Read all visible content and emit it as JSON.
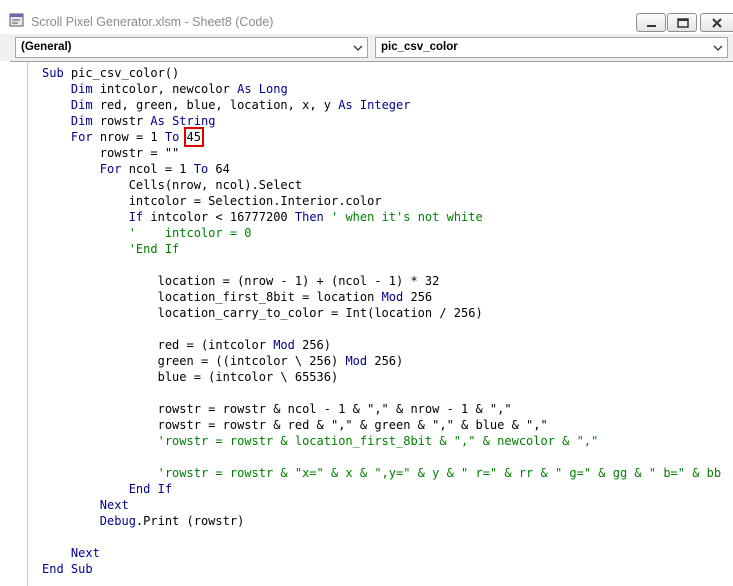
{
  "window": {
    "title": "Scroll Pixel Generator.xlsm - Sheet8 (Code)",
    "icon": "vba-module-icon"
  },
  "combos": {
    "object": "(General)",
    "procedure": "pic_csv_color"
  },
  "code_lines": [
    [
      {
        "t": "Sub",
        "k": "kw"
      },
      {
        "t": " pic_csv_color()"
      }
    ],
    [
      {
        "t": "    "
      },
      {
        "t": "Dim",
        "k": "kw"
      },
      {
        "t": " intcolor, newcolor "
      },
      {
        "t": "As Long",
        "k": "kw"
      }
    ],
    [
      {
        "t": "    "
      },
      {
        "t": "Dim",
        "k": "kw"
      },
      {
        "t": " red, green, blue, location, x, y "
      },
      {
        "t": "As Integer",
        "k": "kw"
      }
    ],
    [
      {
        "t": "    "
      },
      {
        "t": "Dim",
        "k": "kw"
      },
      {
        "t": " rowstr "
      },
      {
        "t": "As String",
        "k": "kw"
      }
    ],
    [
      {
        "t": "    "
      },
      {
        "t": "For",
        "k": "kw"
      },
      {
        "t": " nrow = 1 "
      },
      {
        "t": "To",
        "k": "kw"
      },
      {
        "t": " "
      },
      {
        "t": "45",
        "k": "hl"
      }
    ],
    [
      {
        "t": "        rowstr = \"\""
      }
    ],
    [
      {
        "t": "        "
      },
      {
        "t": "For",
        "k": "kw"
      },
      {
        "t": " ncol = 1 "
      },
      {
        "t": "To",
        "k": "kw"
      },
      {
        "t": " 64"
      }
    ],
    [
      {
        "t": "            Cells(nrow, ncol).Select"
      }
    ],
    [
      {
        "t": "            intcolor = Selection.Interior.color"
      }
    ],
    [
      {
        "t": "            "
      },
      {
        "t": "If",
        "k": "kw"
      },
      {
        "t": " intcolor < 16777200 "
      },
      {
        "t": "Then",
        "k": "kw"
      },
      {
        "t": " ' when it's not white",
        "k": "cm"
      }
    ],
    [
      {
        "t": "            '    intcolor = 0",
        "k": "cm"
      }
    ],
    [
      {
        "t": "            'End If",
        "k": "cm"
      }
    ],
    [
      {
        "t": ""
      }
    ],
    [
      {
        "t": "                location = (nrow - 1) + (ncol - 1) * 32"
      }
    ],
    [
      {
        "t": "                location_first_8bit = location "
      },
      {
        "t": "Mod",
        "k": "kw"
      },
      {
        "t": " 256"
      }
    ],
    [
      {
        "t": "                location_carry_to_color = Int(location / 256)"
      }
    ],
    [
      {
        "t": ""
      }
    ],
    [
      {
        "t": "                red = (intcolor "
      },
      {
        "t": "Mod",
        "k": "kw"
      },
      {
        "t": " 256)"
      }
    ],
    [
      {
        "t": "                green = ((intcolor \\ 256) "
      },
      {
        "t": "Mod",
        "k": "kw"
      },
      {
        "t": " 256)"
      }
    ],
    [
      {
        "t": "                blue = (intcolor \\ 65536)"
      }
    ],
    [
      {
        "t": ""
      }
    ],
    [
      {
        "t": "                rowstr = rowstr & ncol - 1 & \",\" & nrow - 1 & \",\""
      }
    ],
    [
      {
        "t": "                rowstr = rowstr & red & \",\" & green & \",\" & blue & \",\""
      }
    ],
    [
      {
        "t": "                'rowstr = rowstr & location_first_8bit & \",\" & newcolor & \",\"",
        "k": "cm"
      }
    ],
    [
      {
        "t": ""
      }
    ],
    [
      {
        "t": "                'rowstr = rowstr & \"x=\" & x & \",y=\" & y & \" r=\" & rr & \" g=\" & gg & \" b=\" & bb",
        "k": "cm"
      }
    ],
    [
      {
        "t": "            "
      },
      {
        "t": "End If",
        "k": "kw"
      }
    ],
    [
      {
        "t": "        "
      },
      {
        "t": "Next",
        "k": "kw"
      }
    ],
    [
      {
        "t": "        "
      },
      {
        "t": "Debug",
        "k": "kw"
      },
      {
        "t": ".Print (rowstr)"
      }
    ],
    [
      {
        "t": ""
      }
    ],
    [
      {
        "t": "    "
      },
      {
        "t": "Next",
        "k": "kw"
      }
    ],
    [
      {
        "t": "End Sub",
        "k": "kw"
      }
    ]
  ],
  "colors": {
    "keyword": "#00008b",
    "comment": "#008000",
    "highlight_box": "#e00000"
  }
}
